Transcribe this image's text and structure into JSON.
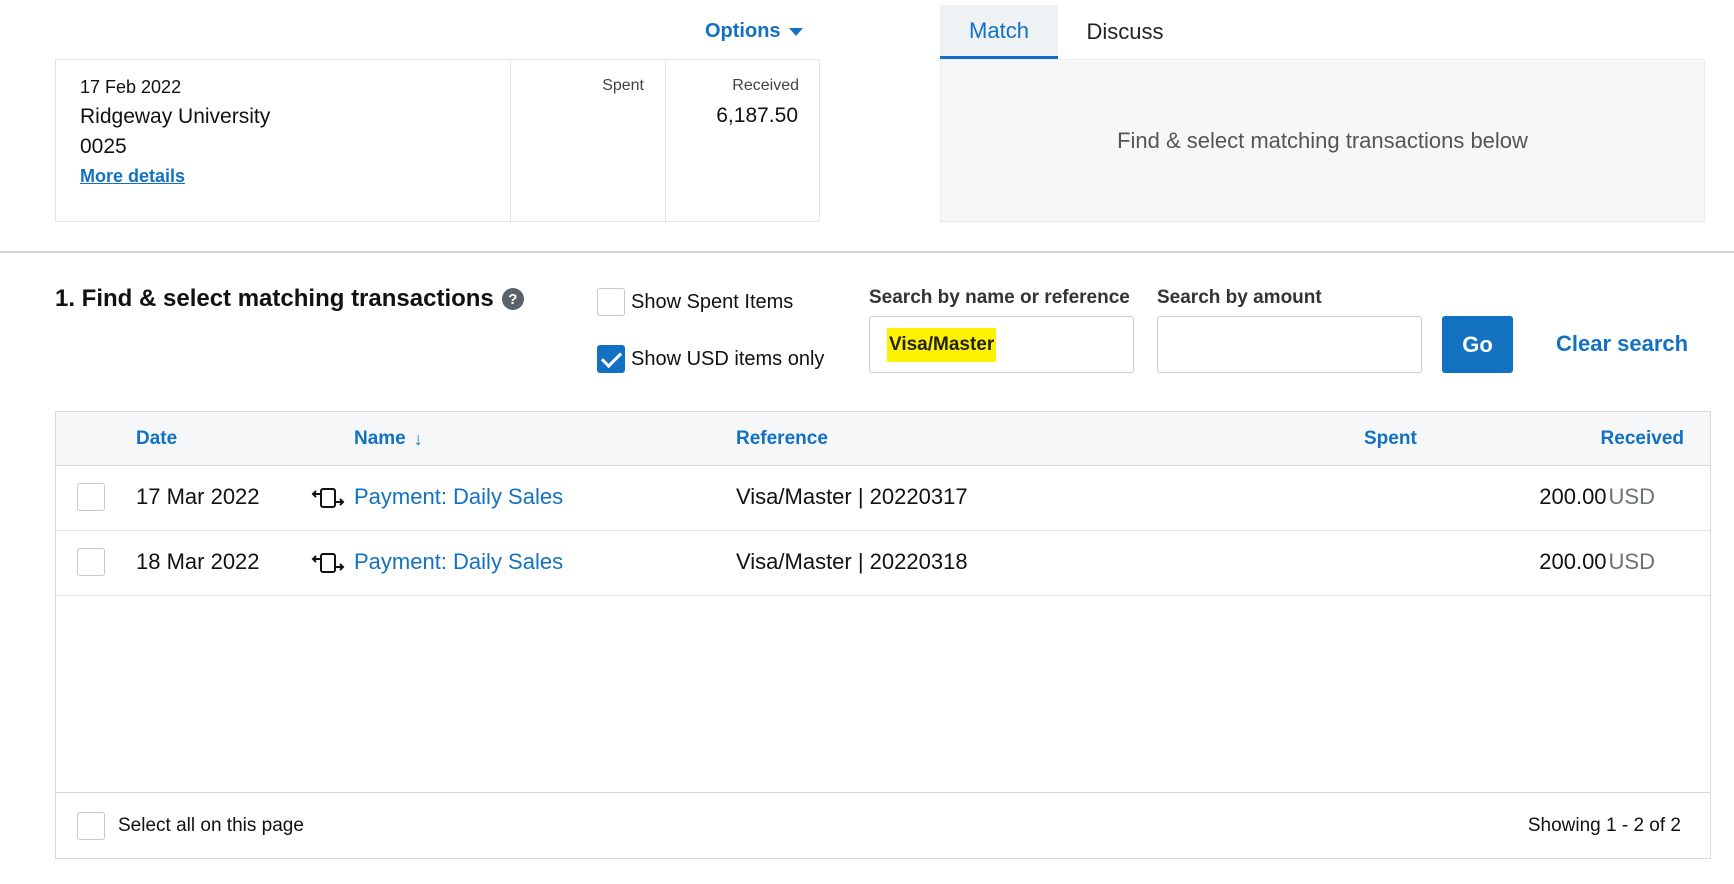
{
  "options": {
    "label": "Options"
  },
  "statement": {
    "date": "17 Feb 2022",
    "payee": "Ridgeway University",
    "reference": "0025",
    "more_details": "More details",
    "spent_label": "Spent",
    "received_label": "Received",
    "received_amount": "6,187.50"
  },
  "tabs": [
    {
      "label": "Match",
      "active": true
    },
    {
      "label": "Discuss",
      "active": false
    }
  ],
  "match_panel": {
    "text": "Find & select matching transactions below"
  },
  "find": {
    "title": "1. Find & select matching transactions",
    "help_glyph": "?",
    "show_spent": {
      "label": "Show Spent Items",
      "checked": false
    },
    "show_usd": {
      "label": "Show USD items only",
      "checked": true
    },
    "search_name": {
      "label": "Search by name or reference",
      "value": "Visa/Master"
    },
    "search_amount": {
      "label": "Search by amount",
      "value": ""
    },
    "go_label": "Go",
    "clear_label": "Clear search"
  },
  "table": {
    "columns": {
      "date": "Date",
      "name": "Name",
      "sort_arrow": "↓",
      "reference": "Reference",
      "spent": "Spent",
      "received": "Received"
    },
    "rows": [
      {
        "date": "17 Mar 2022",
        "icon": "transfer-icon",
        "name": "Payment: Daily Sales",
        "reference": "Visa/Master | 20220317",
        "spent": "",
        "received": "200.00",
        "currency": "USD"
      },
      {
        "date": "18 Mar 2022",
        "icon": "transfer-icon",
        "name": "Payment: Daily Sales",
        "reference": "Visa/Master | 20220318",
        "spent": "",
        "received": "200.00",
        "currency": "USD"
      }
    ],
    "select_all": "Select all on this page",
    "showing": "Showing 1 - 2 of 2"
  },
  "colors": {
    "accent": "#1371c1",
    "highlight": "#fff200",
    "panel": "#f5f7f8"
  }
}
